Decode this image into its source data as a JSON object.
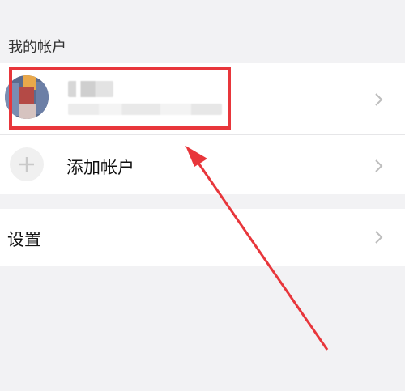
{
  "section_title": "我的帐户",
  "account": {
    "name": "",
    "subtitle": ""
  },
  "add_account": {
    "label": "添加帐户"
  },
  "settings": {
    "label": "设置"
  },
  "colors": {
    "background": "#f2f2f4",
    "card": "#ffffff",
    "highlight": "#e8363b",
    "chevron": "#bdbdbd",
    "text": "#111111"
  },
  "icons": {
    "add": "plus-icon",
    "chevron": "chevron-right-icon"
  }
}
